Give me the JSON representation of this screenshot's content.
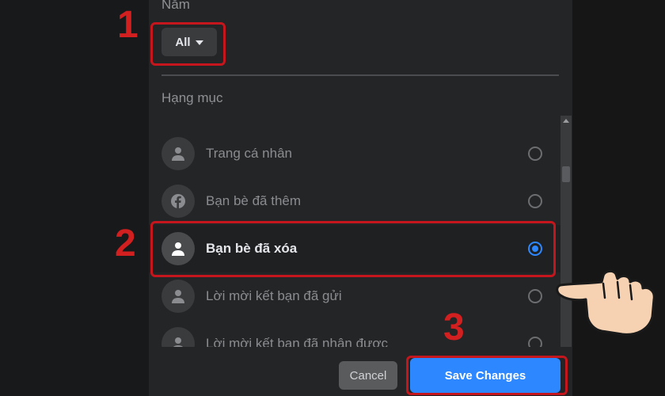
{
  "filters": {
    "year_label": "Năm",
    "year_value": "All",
    "category_label": "Hạng mục"
  },
  "categories": [
    {
      "label": "Trang cá nhân",
      "icon": "person-icon",
      "selected": false
    },
    {
      "label": "Bạn bè đã thêm",
      "icon": "facebook-icon",
      "selected": false
    },
    {
      "label": "Bạn bè đã xóa",
      "icon": "person-icon",
      "selected": true
    },
    {
      "label": "Lời mời kết bạn đã gửi",
      "icon": "person-icon",
      "selected": false
    },
    {
      "label": "Lời mời kết bạn đã nhận được",
      "icon": "person-icon",
      "selected": false
    }
  ],
  "footer": {
    "cancel_label": "Cancel",
    "save_label": "Save Changes"
  },
  "annotations": {
    "step1": "1",
    "step2": "2",
    "step3": "3"
  },
  "colors": {
    "accent": "#2d88ff",
    "highlight": "#c4161c",
    "panel": "#242526"
  }
}
